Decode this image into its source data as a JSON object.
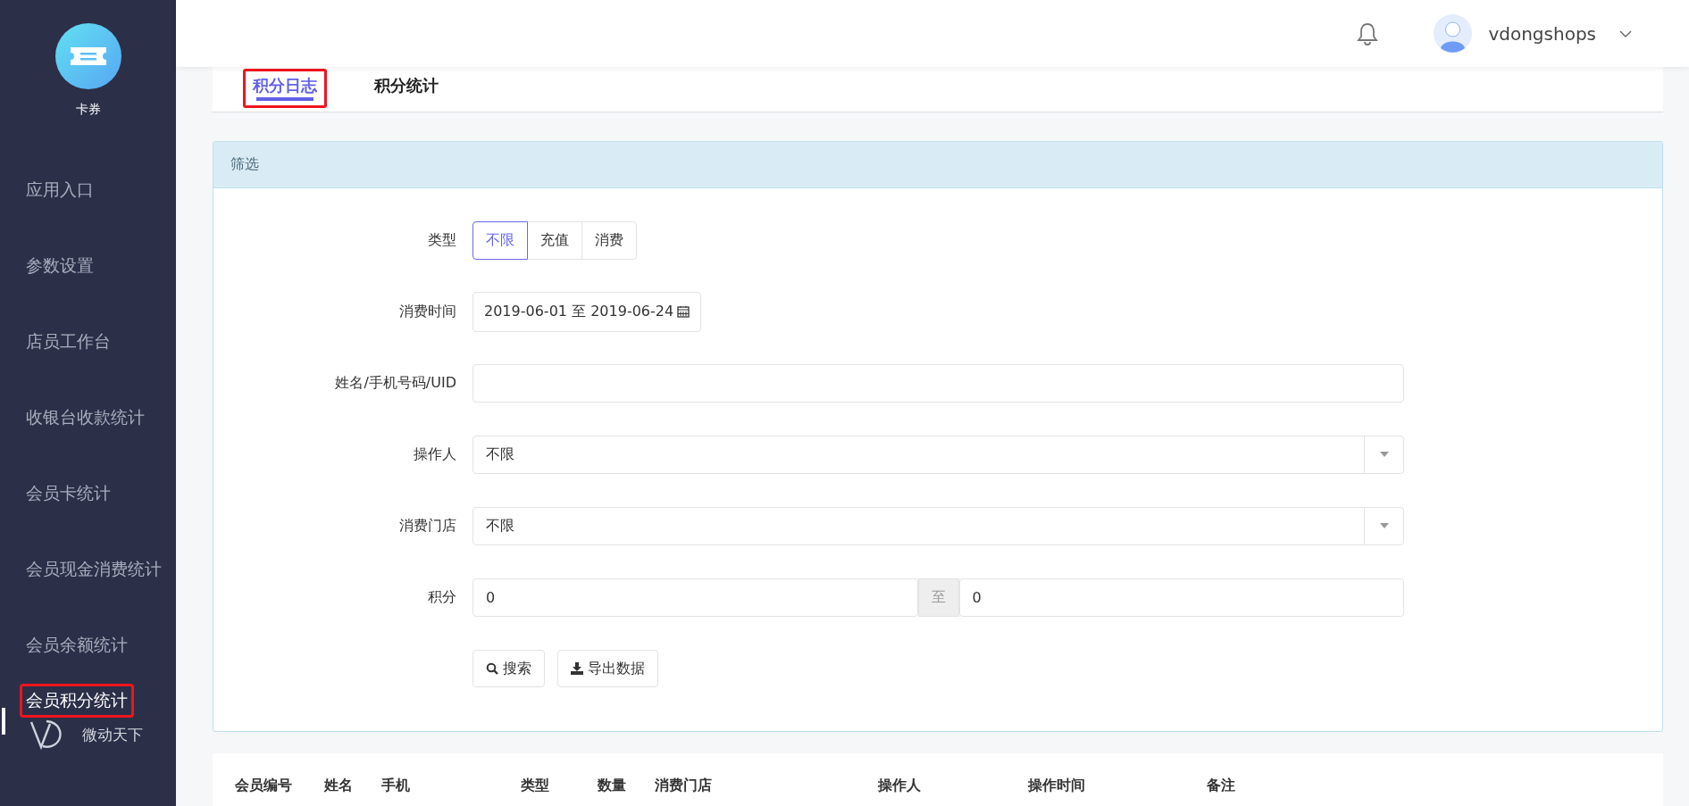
{
  "sidebar": {
    "app_title": "卡券",
    "items": [
      {
        "label": "应用入口",
        "selected": false,
        "highlighted": false
      },
      {
        "label": "参数设置",
        "selected": false,
        "highlighted": false
      },
      {
        "label": "店员工作台",
        "selected": false,
        "highlighted": false
      },
      {
        "label": "收银台收款统计",
        "selected": false,
        "highlighted": false
      },
      {
        "label": "会员卡统计",
        "selected": false,
        "highlighted": false
      },
      {
        "label": "会员现金消费统计",
        "selected": false,
        "highlighted": false
      },
      {
        "label": "会员余额统计",
        "selected": false,
        "highlighted": false
      },
      {
        "label": "会员积分统计",
        "selected": true,
        "highlighted": true
      }
    ],
    "brand": "微动天下"
  },
  "header": {
    "username": "vdongshops"
  },
  "tabs": [
    {
      "label": "积分日志",
      "selected": true,
      "highlighted": true
    },
    {
      "label": "积分统计",
      "selected": false,
      "highlighted": false
    }
  ],
  "filter": {
    "title": "筛选",
    "fields": [
      {
        "kind": "segmented",
        "label": "类型",
        "options": [
          {
            "label": "不限",
            "selected": true
          },
          {
            "label": "充值",
            "selected": false
          },
          {
            "label": "消费",
            "selected": false
          }
        ]
      },
      {
        "kind": "date",
        "label": "消费时间",
        "value": "2019-06-01 至 2019-06-24"
      },
      {
        "kind": "text",
        "label": "姓名/手机号码/UID"
      },
      {
        "kind": "select",
        "label": "操作人",
        "value": "不限"
      },
      {
        "kind": "select",
        "label": "消费门店",
        "value": "不限"
      },
      {
        "kind": "range",
        "label": "积分",
        "from": "0",
        "separator": "至",
        "to": "0"
      }
    ],
    "buttons": [
      {
        "kind": "search",
        "label": "搜索"
      },
      {
        "kind": "export",
        "label": "导出数据"
      }
    ]
  },
  "table": {
    "columns": [
      "会员编号",
      "姓名",
      "手机",
      "类型",
      "数量",
      "消费门店",
      "操作人",
      "操作时间",
      "备注"
    ]
  }
}
